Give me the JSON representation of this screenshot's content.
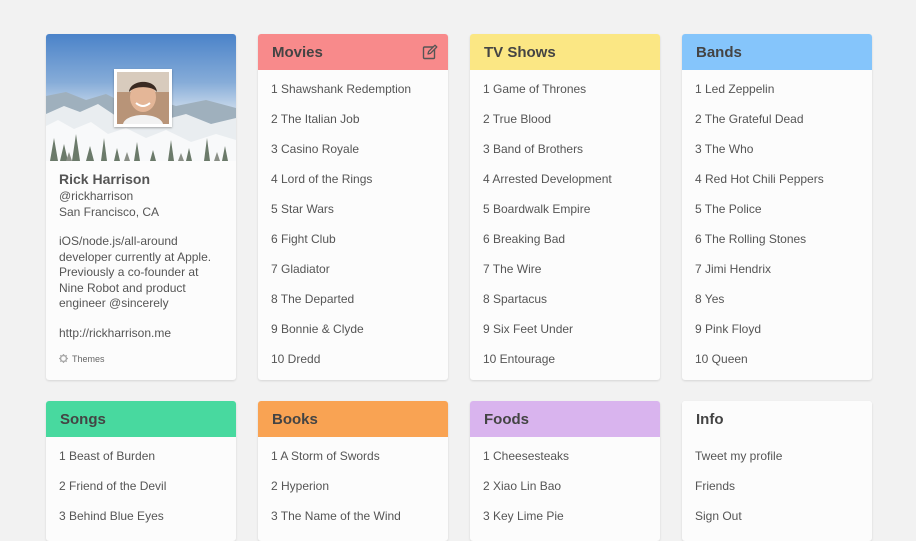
{
  "profile": {
    "name": "Rick Harrison",
    "handle": "@rickharrison",
    "location": "San Francisco, CA",
    "bio": "iOS/node.js/all-around developer currently at Apple. Previously a co-founder at Nine Robot and product engineer @sincerely",
    "url": "http://rickharrison.me",
    "themes_label": "Themes"
  },
  "cards": {
    "movies": {
      "title": "Movies",
      "color": "#f88a8b",
      "items": [
        "1 Shawshank Redemption",
        "2 The Italian Job",
        "3 Casino Royale",
        "4 Lord of the Rings",
        "5 Star Wars",
        "6 Fight Club",
        "7 Gladiator",
        "8 The Departed",
        "9 Bonnie & Clyde",
        "10 Dredd"
      ]
    },
    "tv": {
      "title": "TV Shows",
      "color": "#fbe784",
      "items": [
        "1 Game of Thrones",
        "2 True Blood",
        "3 Band of Brothers",
        "4 Arrested Development",
        "5 Boardwalk Empire",
        "6 Breaking Bad",
        "7 The Wire",
        "8 Spartacus",
        "9 Six Feet Under",
        "10 Entourage"
      ]
    },
    "bands": {
      "title": "Bands",
      "color": "#85c5fb",
      "items": [
        "1 Led Zeppelin",
        "2 The Grateful Dead",
        "3 The Who",
        "4 Red Hot Chili Peppers",
        "5 The Police",
        "6 The Rolling Stones",
        "7 Jimi Hendrix",
        "8 Yes",
        "9 Pink Floyd",
        "10 Queen"
      ]
    },
    "songs": {
      "title": "Songs",
      "color": "#48d99f",
      "items": [
        "1 Beast of Burden",
        "2 Friend of the Devil",
        "3 Behind Blue Eyes"
      ]
    },
    "books": {
      "title": "Books",
      "color": "#f9a353",
      "items": [
        "1 A Storm of Swords",
        "2 Hyperion",
        "3 The Name of the Wind"
      ]
    },
    "foods": {
      "title": "Foods",
      "color": "#d9b4ee",
      "items": [
        "1 Cheesesteaks",
        "2 Xiao Lin Bao",
        "3 Key Lime Pie"
      ]
    },
    "info": {
      "title": "Info",
      "color": "#fcfcfc",
      "items": [
        "Tweet my profile",
        "Friends",
        "Sign Out"
      ]
    }
  },
  "icons": {
    "edit": "edit-icon",
    "themes": "gear-icon"
  }
}
